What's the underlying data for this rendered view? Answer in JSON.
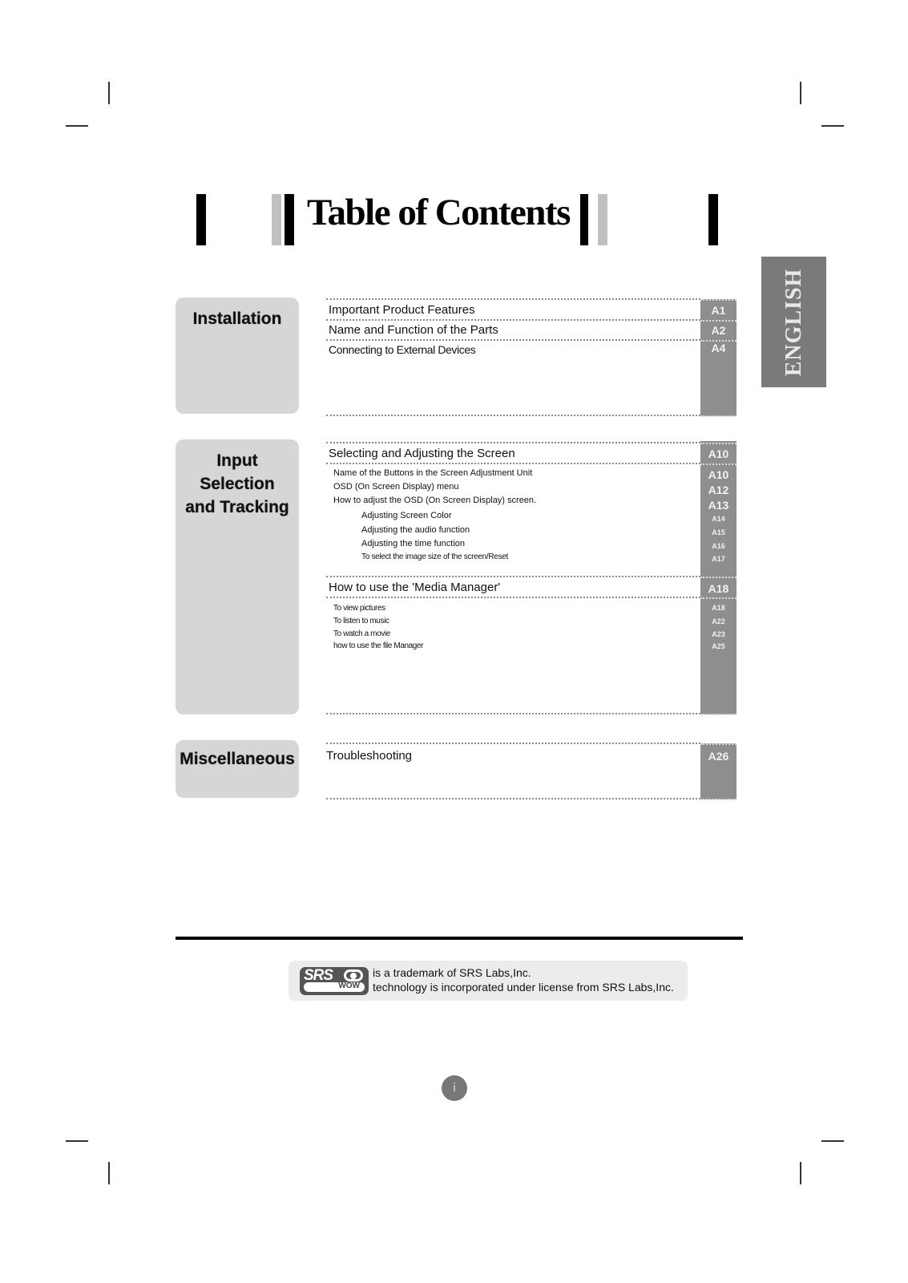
{
  "header": {
    "title": "Table of Contents"
  },
  "language_tab": {
    "label": "ENGLISH"
  },
  "sections": [
    {
      "label": "Installation",
      "entries": [
        {
          "text": "Important Product Features",
          "page": "A1"
        },
        {
          "text": "Name and Function of the Parts",
          "page": "A2"
        },
        {
          "text": "Connecting to External Devices",
          "page": "A4"
        }
      ]
    },
    {
      "label_lines": [
        "Input",
        "Selection",
        "and Tracking"
      ],
      "groups": [
        {
          "heading": {
            "text": "Selecting and Adjusting the Screen",
            "page": "A10"
          },
          "entries": [
            {
              "text": "Name of the Buttons in the Screen Adjustment Unit",
              "page": "A10"
            },
            {
              "text": "OSD (On Screen Display) menu",
              "page": "A12"
            },
            {
              "text": "How to adjust the OSD (On Screen Display) screen.",
              "page": "A13"
            },
            {
              "text": "Adjusting Screen Color",
              "page": "A14"
            },
            {
              "text": "Adjusting the audio function",
              "page": "A15"
            },
            {
              "text": "Adjusting the time function",
              "page": "A16"
            },
            {
              "text": "To select the image size of the screen/Reset",
              "page": "A17"
            }
          ]
        },
        {
          "heading": {
            "text": "How to use the 'Media Manager'",
            "page": "A18"
          },
          "entries": [
            {
              "text": "To view pictures",
              "page": "A18"
            },
            {
              "text": "To listen to music",
              "page": "A22"
            },
            {
              "text": "To watch a movie",
              "page": "A23"
            },
            {
              "text": "how to use the file Manager",
              "page": "A25"
            }
          ]
        }
      ]
    },
    {
      "label": "Miscellaneous",
      "entries": [
        {
          "text": "Troubleshooting",
          "page": "A26"
        }
      ]
    }
  ],
  "footer": {
    "srs_logo": {
      "name": "srs-wow-logo",
      "top_text": "SRS",
      "bottom_text": "WOW"
    },
    "trademark_line1": "is a trademark of SRS Labs,Inc.",
    "trademark_line2": "technology is incorporated under license from SRS Labs,Inc.",
    "page_number": "i"
  }
}
